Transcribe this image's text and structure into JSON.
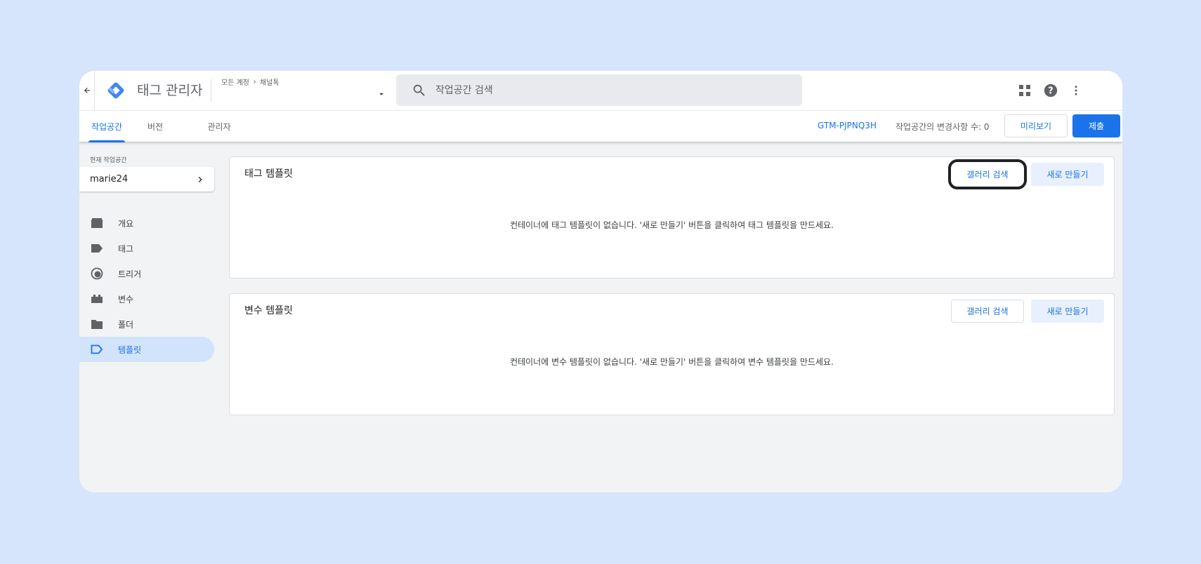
{
  "header": {
    "title": "태그 관리자",
    "breadcrumb": [
      "모든 계정",
      "채널톡"
    ],
    "search_placeholder": "작업공간 검색"
  },
  "tabs": [
    {
      "label": "작업공간",
      "active": true
    },
    {
      "label": "버전",
      "active": false
    },
    {
      "label": "관리자",
      "active": false
    }
  ],
  "toolbar": {
    "container_id": "GTM-PJPNQ3H",
    "changes_text": "작업공간의 변경사항 수: 0",
    "preview_label": "미리보기",
    "submit_label": "제출"
  },
  "sidebar": {
    "workspace_label": "현재 작업공간",
    "workspace_name": "marie24",
    "items": [
      {
        "label": "개요",
        "icon": "overview-icon",
        "active": false
      },
      {
        "label": "태그",
        "icon": "tag-icon",
        "active": false
      },
      {
        "label": "트리거",
        "icon": "trigger-icon",
        "active": false
      },
      {
        "label": "변수",
        "icon": "variable-icon",
        "active": false
      },
      {
        "label": "폴더",
        "icon": "folder-icon",
        "active": false
      },
      {
        "label": "템플릿",
        "icon": "template-icon",
        "active": true
      }
    ]
  },
  "tag_templates": {
    "title": "태그 템플릿",
    "gallery_label": "갤러리 검색",
    "new_label": "새로 만들기",
    "empty_text": "컨테이너에 태그 템플릿이 없습니다. '새로 만들기' 버튼을 클릭하여 태그 템플릿을 만드세요."
  },
  "variable_templates": {
    "title": "변수 템플릿",
    "gallery_label": "갤러리 검색",
    "new_label": "새로 만들기",
    "empty_text": "컨테이너에 변수 템플릿이 없습니다. '새로 만들기' 버튼을 클릭하여 변수 템플릿을 만드세요."
  },
  "colors": {
    "accent": "#1a73e8",
    "page_background": "#d6e5fb",
    "active_nav": "#d2e3fc"
  }
}
